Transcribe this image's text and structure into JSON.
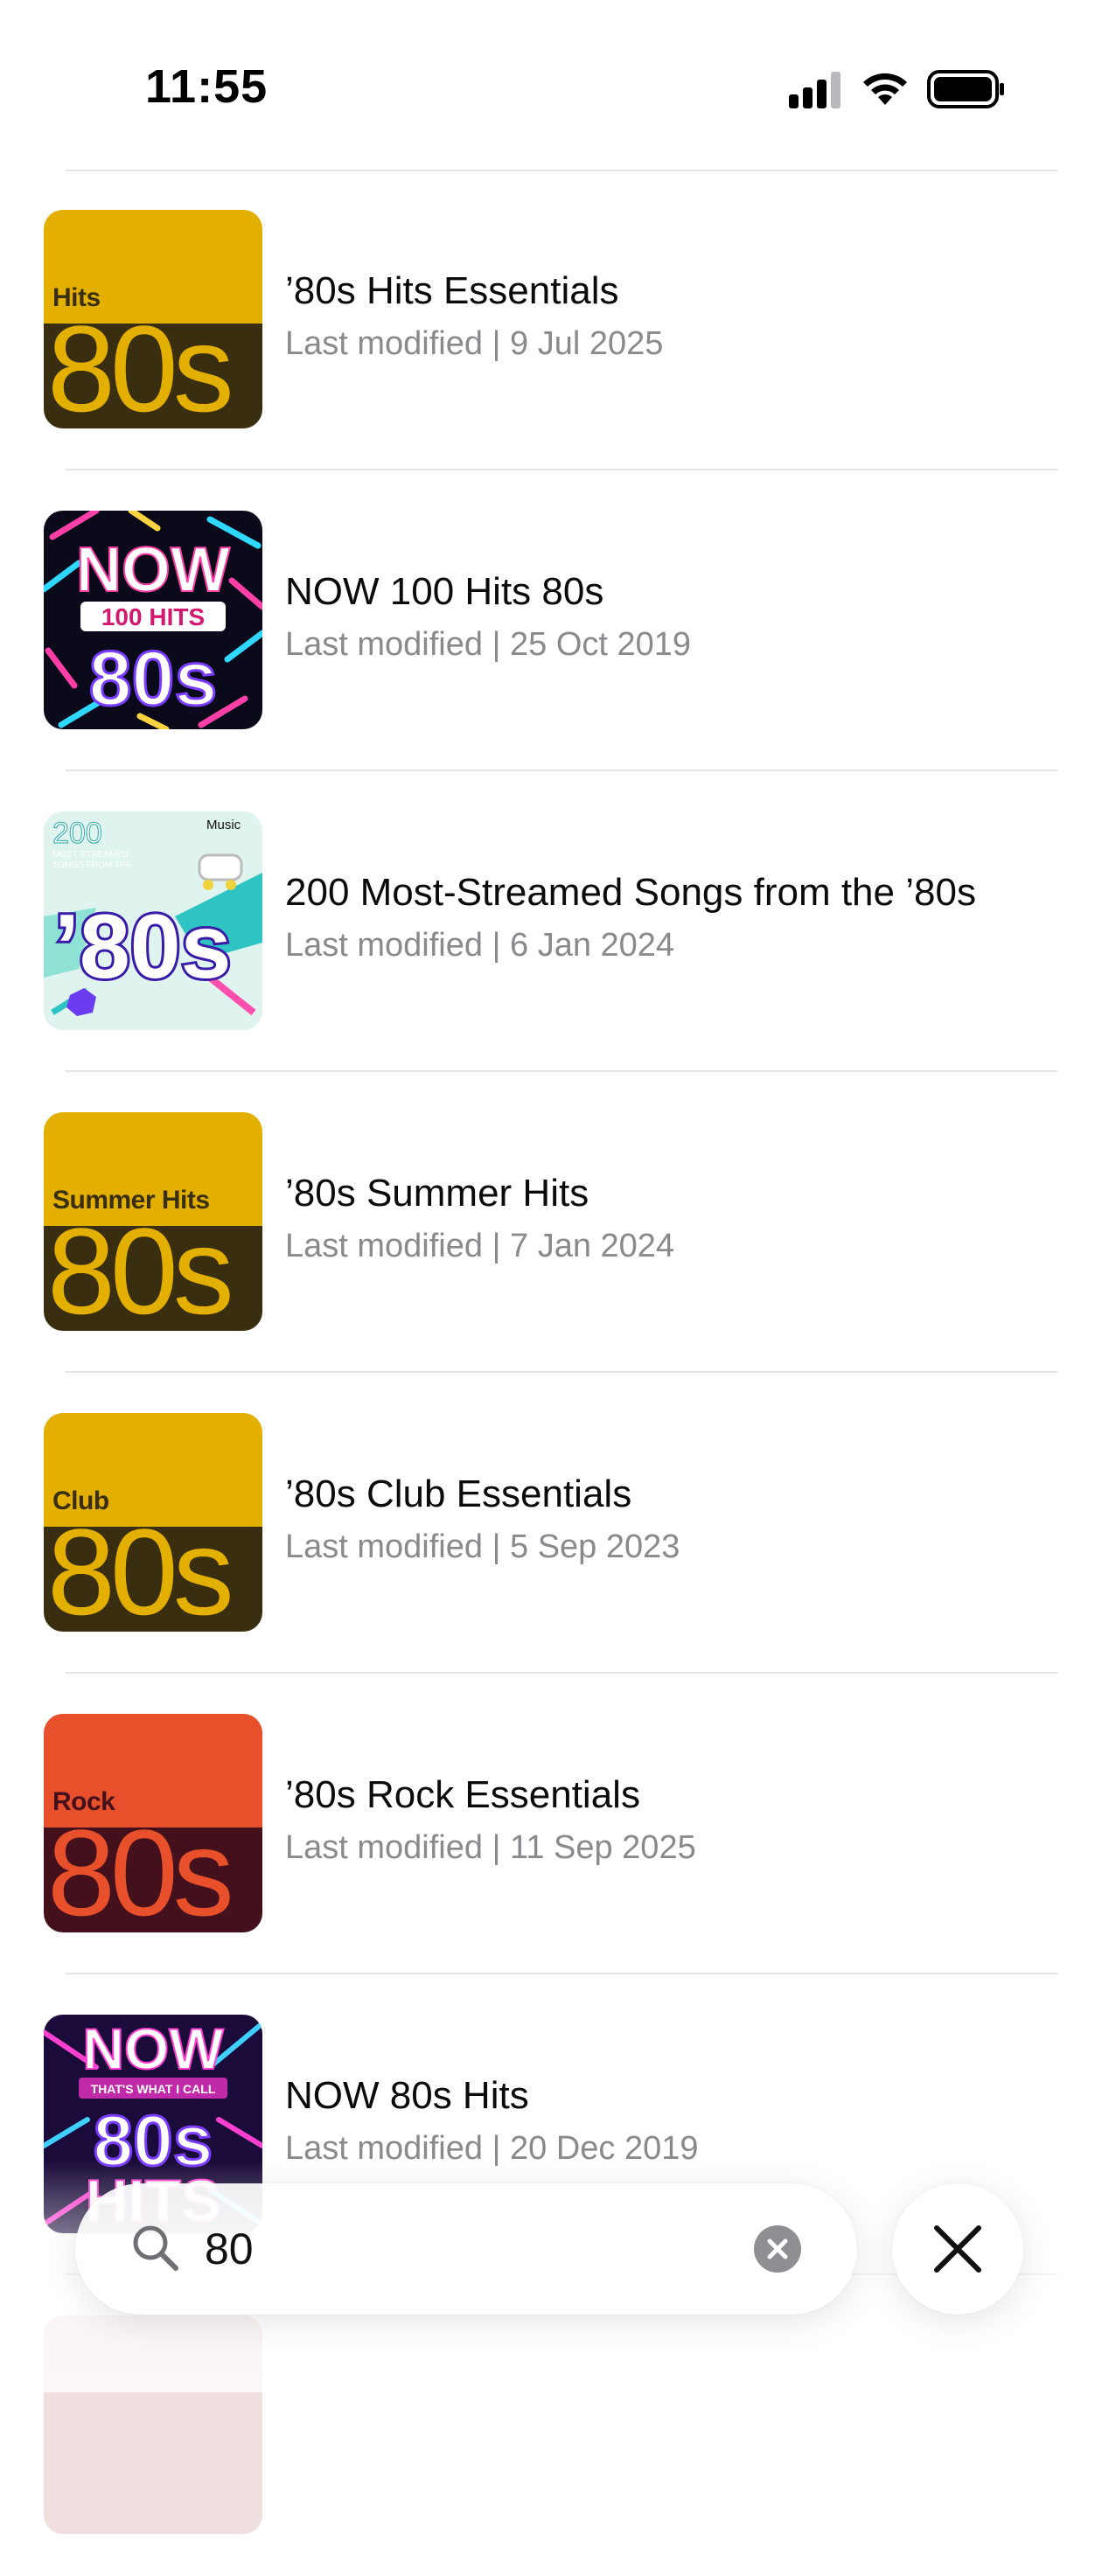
{
  "status_bar": {
    "time": "11:55",
    "icons": [
      "signal-icon",
      "wifi-icon",
      "battery-icon"
    ]
  },
  "results": [
    {
      "title": "’80s Hits Essentials",
      "subtitle": "Last modified | 9 Jul 2025",
      "artwork": {
        "style": "two-tone",
        "label": "Hits",
        "big": "80s",
        "top_color": "#e3b000",
        "bottom_color": "#3a2e10",
        "text_color": "#e3b000"
      }
    },
    {
      "title": "NOW 100 Hits 80s",
      "subtitle": "Last modified | 25 Oct 2019",
      "artwork": {
        "style": "now",
        "line1": "NOW",
        "line2": "100 HITS",
        "line3": "80s"
      }
    },
    {
      "title": "200 Most-Streamed Songs from the ’80s",
      "subtitle": "Last modified | 6 Jan 2024",
      "artwork": {
        "style": "streamed",
        "line1": "200",
        "line2": "MOST STREAMED",
        "line3": "SONGS FROM THE",
        "big": "’80s",
        "badge": "Music"
      }
    },
    {
      "title": "’80s Summer Hits",
      "subtitle": "Last modified | 7 Jan 2024",
      "artwork": {
        "style": "two-tone",
        "label": "Summer Hits",
        "big": "80s",
        "top_color": "#e3b000",
        "bottom_color": "#3a2e10",
        "text_color": "#e3b000"
      }
    },
    {
      "title": "’80s Club Essentials",
      "subtitle": "Last modified | 5 Sep 2023",
      "artwork": {
        "style": "two-tone",
        "label": "Club",
        "big": "80s",
        "top_color": "#e3b000",
        "bottom_color": "#3a2e10",
        "text_color": "#e3b000"
      }
    },
    {
      "title": "’80s Rock Essentials",
      "subtitle": "Last modified | 11 Sep 2025",
      "artwork": {
        "style": "two-tone",
        "label": "Rock",
        "big": "80s",
        "top_color": "#e8502c",
        "bottom_color": "#44101c",
        "text_color": "#e8502c"
      }
    },
    {
      "title": "NOW 80s Hits",
      "subtitle": "Last modified | 20 Dec 2019",
      "artwork": {
        "style": "now2",
        "line1": "NOW",
        "line2": "THAT'S WHAT I CALL",
        "line3": "80s",
        "line4": "HITS"
      }
    }
  ],
  "search": {
    "value": "80",
    "clear_icon": "clear-icon",
    "close_icon": "close-icon"
  },
  "colors": {
    "accent_text": "#0b0b0b",
    "secondary_text": "#8a8a8e",
    "divider": "#e3e3e6"
  }
}
